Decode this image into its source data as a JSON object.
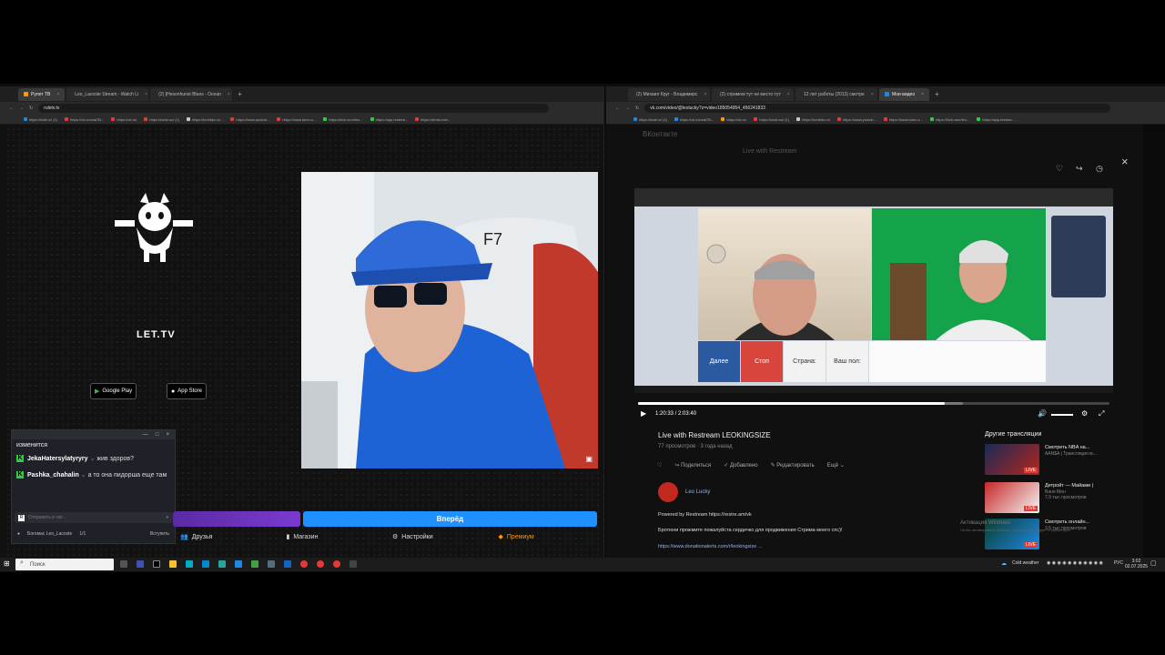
{
  "left_browser": {
    "tabs": [
      {
        "label": "Рулет ТВ",
        "active": true,
        "color": "#ff9800"
      },
      {
        "label": "Leo_Lacoste Stream - Watch Li",
        "active": false,
        "color": "#2ecc40"
      },
      {
        "label": "(2) [Hesonhunst Blues - Ocean",
        "active": false,
        "color": "#e53935"
      }
    ],
    "url": "ruletv.tv",
    "bookmarks": [
      {
        "label": "https://mail.ru/ (1)",
        "color": "#1e88e5"
      },
      {
        "label": "https://vk.com/al7B...",
        "color": "#e53935"
      },
      {
        "label": "https://ok.ru/",
        "color": "#e53935"
      },
      {
        "label": "https://tanki.su/ (1)",
        "color": "#e53935"
      },
      {
        "label": "https://tomtldo.ru/...",
        "color": "#cccccc"
      },
      {
        "label": "https://www.youtub...",
        "color": "#e53935"
      },
      {
        "label": "https://www.tomu.s...",
        "color": "#e53935"
      },
      {
        "label": "https://kick.com/leo...",
        "color": "#2ecc40"
      },
      {
        "label": "https://app.restrea...",
        "color": "#2ecc40"
      },
      {
        "label": "https://dtmto.me/...",
        "color": "#e53935"
      }
    ]
  },
  "ruletv": {
    "logo_text": "LET.TV",
    "google_play": "Google Play",
    "app_store": "App Store",
    "chat": {
      "partial_line": "изменится",
      "messages": [
        {
          "user": "JekaHatersylatyryry",
          "text": "жив здоров?"
        },
        {
          "user": "Pashka_chahalin",
          "text": "а то она пидорша еще там"
        }
      ],
      "input_placeholder": "Отправить в чат...",
      "footer_user": "Богомас Leo_Lacoste",
      "footer_count": "1/1",
      "footer_action": "Вступить"
    },
    "start_button": "Вперёд",
    "nav": [
      "Друзья",
      "Магазин",
      "Настройки",
      "Премиум"
    ]
  },
  "right_browser": {
    "tabs": [
      {
        "label": "(2) Михаил Круг - Владимирс",
        "active": false,
        "color": "#e53935"
      },
      {
        "label": "(2) стримом тут не место тут",
        "active": false,
        "color": "#e53935"
      },
      {
        "label": "12 лет работы (2013) смотре",
        "active": false,
        "color": "#cccccc"
      },
      {
        "label": "Мои видео",
        "active": true,
        "color": "#1e88e5"
      }
    ],
    "url": "vk.com/video/@leolucky?z=video185054954_456241833",
    "bookmarks": [
      {
        "label": "https://mail.ru/ (1)",
        "color": "#1e88e5"
      },
      {
        "label": "https://vk.com/al7B...",
        "color": "#1e88e5"
      },
      {
        "label": "https://ok.ru/",
        "color": "#ff9800"
      },
      {
        "label": "https://tanki.su/ (1)",
        "color": "#e53935"
      },
      {
        "label": "https://tomtldo.ru/",
        "color": "#cccccc"
      },
      {
        "label": "https://www.youtub...",
        "color": "#e53935"
      },
      {
        "label": "https://www.tomu.s...",
        "color": "#e53935"
      },
      {
        "label": "https://kick.com/leo...",
        "color": "#2ecc40"
      },
      {
        "label": "https://app.restrea...",
        "color": "#2ecc40"
      }
    ]
  },
  "vk": {
    "brand": "ВКонтакте",
    "ghost_title": "Live with Restream",
    "player": {
      "buttons": [
        {
          "label": "Далее",
          "bg": "#2c5aa0",
          "fg": "#ffffff"
        },
        {
          "label": "Стоп",
          "bg": "#d8453d",
          "fg": "#ffffff"
        },
        {
          "label": "Страна:",
          "bg": "#f2f2f2",
          "fg": "#333333"
        },
        {
          "label": "Ваш пол:",
          "bg": "#f2f2f2",
          "fg": "#333333"
        }
      ],
      "time": "1:20:33 / 2:03:40",
      "progress": 0.65,
      "buffered": 0.69
    },
    "title": "Live with Restream LEOKINGSIZE",
    "meta": "77 просмотров · 3 года назад",
    "actions": [
      "Поделиться",
      "Добавлено",
      "Редактировать",
      "Ещё"
    ],
    "author": "Leo Lucky",
    "description": [
      "Powered by Restream https://restre.am/vk",
      "Бротюни прожмите пожалуйста сердечко для продвижения Стрима моего спс)!",
      "https://www.donationalerts.com/r/leokingsize ..."
    ],
    "sidebar_title": "Другие трансляции",
    "sidebar": [
      {
        "title": "Смотреть NBA на...",
        "sub": "AAN$A | Трансляция м...",
        "views": ""
      },
      {
        "title": "Детройт — Майами |",
        "sub": "Ваня Мен",
        "views": "7,9 тыс просмотров"
      },
      {
        "title": "Смотреть онлайн...",
        "sub": "",
        "views": "3,5 тыс просмотров"
      }
    ],
    "live_badge": "LIVE",
    "watermark_1": "Активация Windows",
    "watermark_2": "Чтобы активировать Windows, перейдите в раздел «Параметры»."
  },
  "taskbar": {
    "search_placeholder": "Поиск",
    "weather": "Cold weather",
    "lang": "РУС",
    "time": "3:02",
    "date": "02.07.2025"
  }
}
